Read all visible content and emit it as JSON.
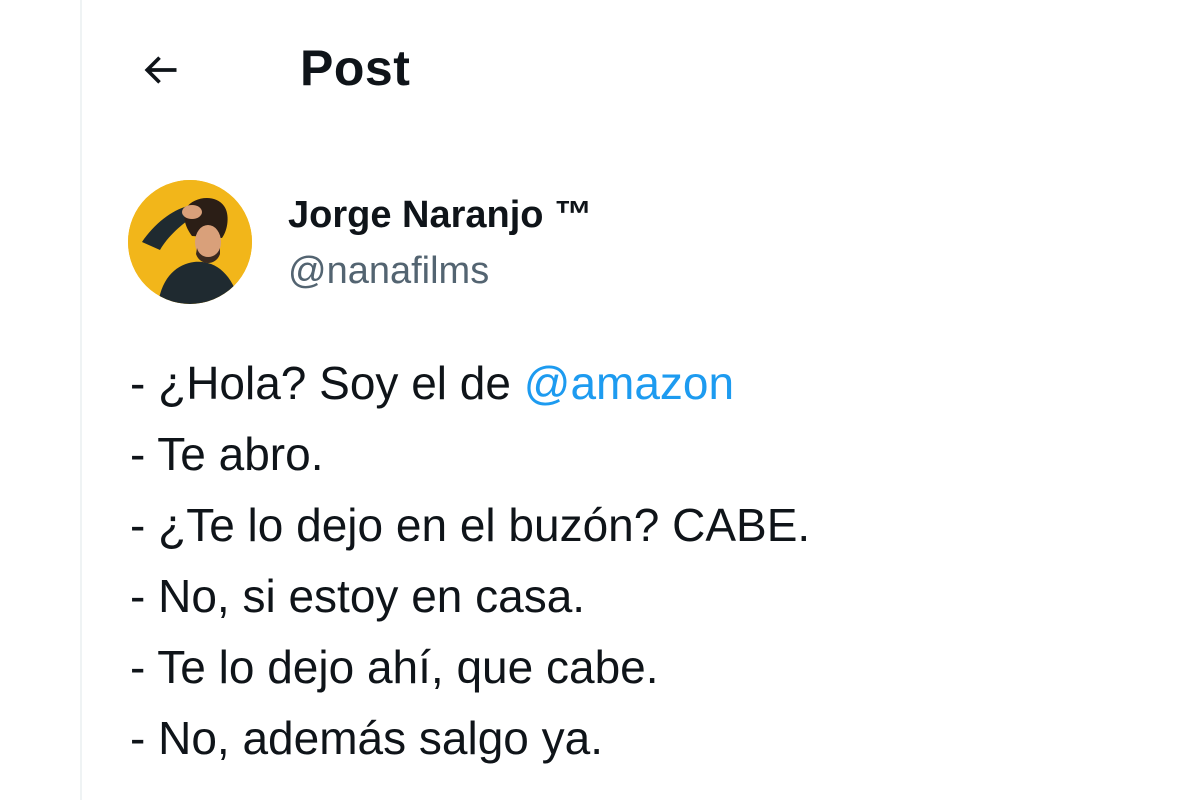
{
  "header": {
    "back_icon": "arrow-left-icon",
    "title": "Post"
  },
  "author": {
    "avatar_icon": "profile-photo",
    "display_name": "Jorge Naranjo ™",
    "handle": "@nanafilms"
  },
  "tweet": {
    "lines": [
      {
        "prefix": "- ¿Hola? Soy el de ",
        "mention": "@amazon"
      },
      {
        "text": "- Te abro."
      },
      {
        "text": "- ¿Te lo dejo en el buzón? CABE."
      },
      {
        "text": "- No, si estoy en casa."
      },
      {
        "text": "- Te lo dejo ahí, que cabe."
      },
      {
        "text": "- No, además salgo ya."
      }
    ]
  },
  "colors": {
    "text": "#0f1419",
    "secondary": "#536471",
    "link": "#1d9bf0",
    "avatar_bg": "#f2b61a"
  }
}
